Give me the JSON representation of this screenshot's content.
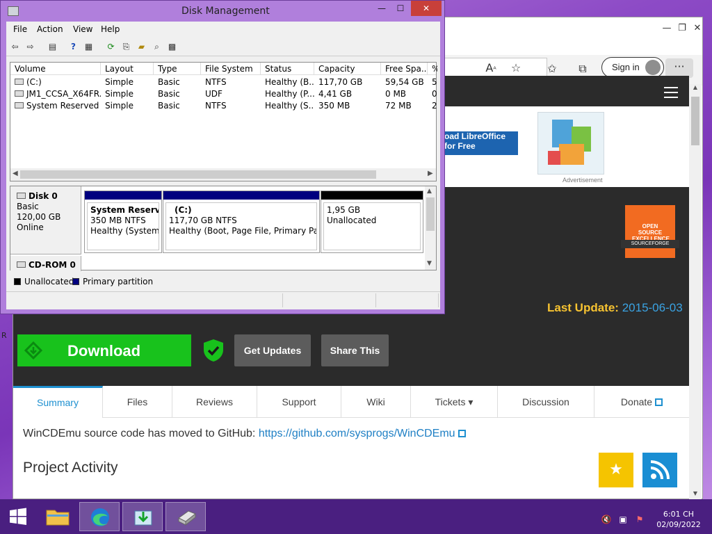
{
  "browser": {
    "signin_label": "Sign in",
    "ad": {
      "banner_text": "oad LibreOffice for Free",
      "label": "Advertisement"
    },
    "badge": {
      "line1": "OPEN SOURCE EXCELLENCE",
      "ribbon": "SOURCEFORGE"
    },
    "last_update_label": "Last Update:",
    "last_update_value": "2015-06-03",
    "download_label": "Download",
    "get_updates_label": "Get Updates",
    "share_label": "Share This",
    "tabs": [
      {
        "label": "Summary"
      },
      {
        "label": "Files"
      },
      {
        "label": "Reviews"
      },
      {
        "label": "Support"
      },
      {
        "label": "Wiki"
      },
      {
        "label": "Tickets ▾"
      },
      {
        "label": "Discussion"
      },
      {
        "label": "Donate"
      }
    ],
    "moved_text": "WinCDEmu source code has moved to GitHub:",
    "moved_link": "https://github.com/sysprogs/WinCDEmu",
    "project_activity": "Project Activity",
    "colors": {
      "download": "#18c21c",
      "accent": "#1e90d0",
      "last_update_label": "#f7c331"
    }
  },
  "disk_management": {
    "title": "Disk Management",
    "menu": [
      "File",
      "Action",
      "View",
      "Help"
    ],
    "columns": [
      "Volume",
      "Layout",
      "Type",
      "File System",
      "Status",
      "Capacity",
      "Free Spa...",
      "%"
    ],
    "volumes": [
      {
        "volume": "(C:)",
        "layout": "Simple",
        "type": "Basic",
        "fs": "NTFS",
        "status": "Healthy (B...",
        "capacity": "117,70 GB",
        "free": "59,54 GB",
        "pct": "5"
      },
      {
        "volume": "JM1_CCSA_X64FR...",
        "layout": "Simple",
        "type": "Basic",
        "fs": "UDF",
        "status": "Healthy (P...",
        "capacity": "4,41 GB",
        "free": "0 MB",
        "pct": "0"
      },
      {
        "volume": "System Reserved",
        "layout": "Simple",
        "type": "Basic",
        "fs": "NTFS",
        "status": "Healthy (S...",
        "capacity": "350 MB",
        "free": "72 MB",
        "pct": "2"
      }
    ],
    "disk0": {
      "name": "Disk 0",
      "type": "Basic",
      "size": "120,00 GB",
      "state": "Online",
      "partitions": [
        {
          "title": "System Reserved",
          "line2": "350 MB NTFS",
          "line3": "Healthy (System, A"
        },
        {
          "title": "(C:)",
          "line2": "117,70 GB NTFS",
          "line3": "Healthy (Boot, Page File, Primary Partitic"
        },
        {
          "title": "",
          "line2": "1,95 GB",
          "line3": "Unallocated"
        }
      ]
    },
    "cdrom": {
      "name": "CD-ROM 0"
    },
    "legend": {
      "unallocated": "Unallocated",
      "primary": "Primary partition"
    }
  },
  "taskbar": {
    "time": "6:01 CH",
    "date": "02/09/2022"
  },
  "misc": {
    "r_label": "R"
  }
}
